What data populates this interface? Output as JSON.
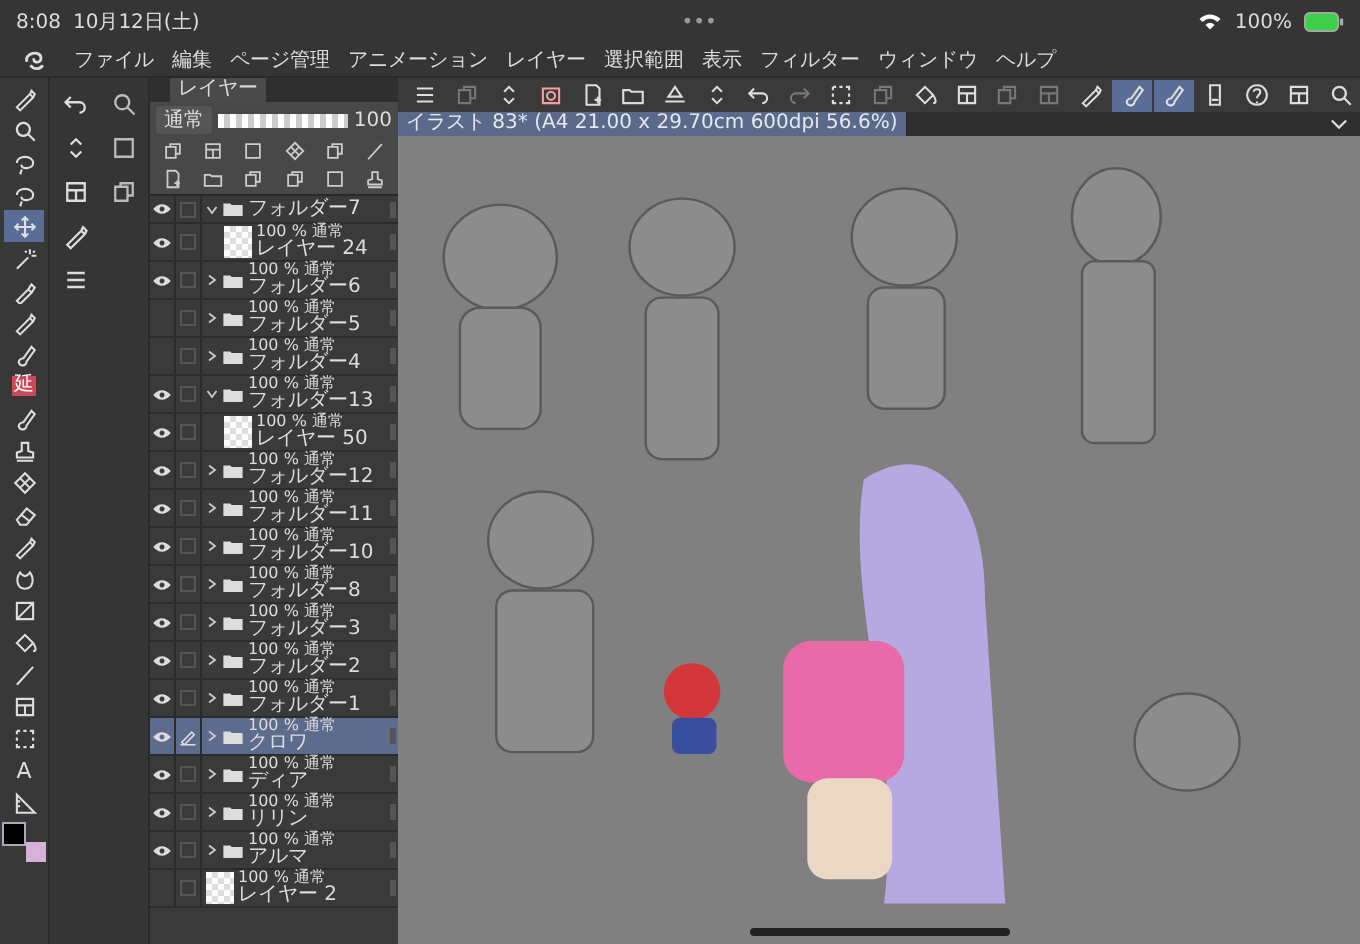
{
  "status_bar": {
    "time": "8:08",
    "date": "10月12日(土)",
    "dots": "•••",
    "battery": "100%"
  },
  "menu": [
    "ファイル",
    "編集",
    "ページ管理",
    "アニメーション",
    "レイヤー",
    "選択範囲",
    "表示",
    "フィルター",
    "ウィンドウ",
    "ヘルプ"
  ],
  "tools": [
    {
      "selected": false
    },
    {
      "selected": false
    },
    {
      "selected": false
    },
    {
      "selected": false
    },
    {
      "selected": true
    },
    {
      "selected": false
    },
    {
      "selected": false
    },
    {
      "selected": false
    },
    {
      "selected": false
    },
    {
      "selected": false,
      "label": "延"
    },
    {
      "selected": false
    },
    {
      "selected": false
    },
    {
      "selected": false
    },
    {
      "selected": false
    },
    {
      "selected": false
    },
    {
      "selected": false
    },
    {
      "selected": false
    },
    {
      "selected": false
    },
    {
      "selected": false
    },
    {
      "selected": false
    },
    {
      "selected": false
    },
    {
      "selected": false,
      "label": "A"
    },
    {
      "selected": false
    }
  ],
  "toolbar": [
    {
      "selected": false,
      "disabled": false
    },
    {
      "selected": false,
      "disabled": true
    },
    {
      "selected": false,
      "disabled": false
    },
    {
      "selected": false,
      "disabled": false
    },
    {
      "selected": false,
      "disabled": false
    },
    {
      "selected": false,
      "disabled": false
    },
    {
      "selected": false,
      "disabled": false
    },
    {
      "selected": false,
      "disabled": false
    },
    {
      "selected": false,
      "disabled": false
    },
    {
      "selected": false,
      "disabled": true
    },
    {
      "selected": false,
      "disabled": false
    },
    {
      "selected": false,
      "disabled": true
    },
    {
      "selected": false,
      "disabled": false
    },
    {
      "selected": false,
      "disabled": false
    },
    {
      "selected": false,
      "disabled": true
    },
    {
      "selected": false,
      "disabled": true
    },
    {
      "selected": false,
      "disabled": false
    },
    {
      "selected": true,
      "disabled": false
    },
    {
      "selected": true,
      "disabled": false
    },
    {
      "selected": false,
      "disabled": false
    },
    {
      "selected": false,
      "disabled": false
    },
    {
      "selected": false,
      "disabled": false
    },
    {
      "selected": false,
      "disabled": false
    }
  ],
  "canvas_tab": {
    "title": "イラスト 83* (A4 21.00 x 29.70cm 600dpi 56.6%)"
  },
  "layer_panel": {
    "tab": "レイヤー",
    "blend": "通常",
    "opacity": "100",
    "opacity_slider": {
      "level": 1.0
    },
    "layers": [
      {
        "kind": "folder",
        "name": "フォルダー7",
        "visible": true,
        "expanded": true,
        "selected": false,
        "children": [
          {
            "kind": "layer",
            "name": "レイヤー 24",
            "blend": "100 % 通常",
            "visible": true,
            "selected": false
          }
        ]
      },
      {
        "kind": "folder",
        "name": "フォルダー6",
        "blend": "100 % 通常",
        "visible": true,
        "expanded": false,
        "selected": false
      },
      {
        "kind": "folder",
        "name": "フォルダー5",
        "blend": "100 % 通常",
        "visible": false,
        "expanded": false,
        "selected": false
      },
      {
        "kind": "folder",
        "name": "フォルダー4",
        "blend": "100 % 通常",
        "visible": false,
        "expanded": false,
        "selected": false
      },
      {
        "kind": "folder",
        "name": "フォルダー13",
        "blend": "100 % 通常",
        "visible": true,
        "expanded": true,
        "selected": false,
        "children": [
          {
            "kind": "layer",
            "name": "レイヤー 50",
            "blend": "100 % 通常",
            "visible": true,
            "selected": false
          }
        ]
      },
      {
        "kind": "folder",
        "name": "フォルダー12",
        "blend": "100 % 通常",
        "visible": true,
        "expanded": false,
        "selected": false
      },
      {
        "kind": "folder",
        "name": "フォルダー11",
        "blend": "100 % 通常",
        "visible": true,
        "expanded": false,
        "selected": false
      },
      {
        "kind": "folder",
        "name": "フォルダー10",
        "blend": "100 % 通常",
        "visible": true,
        "expanded": false,
        "selected": false
      },
      {
        "kind": "folder",
        "name": "フォルダー8",
        "blend": "100 % 通常",
        "visible": true,
        "expanded": false,
        "selected": false
      },
      {
        "kind": "folder",
        "name": "フォルダー3",
        "blend": "100 % 通常",
        "visible": true,
        "expanded": false,
        "selected": false
      },
      {
        "kind": "folder",
        "name": "フォルダー2",
        "blend": "100 % 通常",
        "visible": true,
        "expanded": false,
        "selected": false
      },
      {
        "kind": "folder",
        "name": "フォルダー1",
        "blend": "100 % 通常",
        "visible": true,
        "expanded": false,
        "selected": false
      },
      {
        "kind": "folder",
        "name": "クロワ",
        "blend": "100 % 通常",
        "visible": true,
        "expanded": false,
        "selected": true
      },
      {
        "kind": "folder",
        "name": "ディア",
        "blend": "100 % 通常",
        "visible": true,
        "expanded": false,
        "selected": false
      },
      {
        "kind": "folder",
        "name": "リリン",
        "blend": "100 % 通常",
        "visible": true,
        "expanded": false,
        "selected": false
      },
      {
        "kind": "folder",
        "name": "アルマ",
        "blend": "100 % 通常",
        "visible": true,
        "expanded": false,
        "selected": false
      },
      {
        "kind": "layer",
        "name": "レイヤー 2",
        "blend": "100 % 通常",
        "visible": false,
        "selected": false
      }
    ]
  }
}
